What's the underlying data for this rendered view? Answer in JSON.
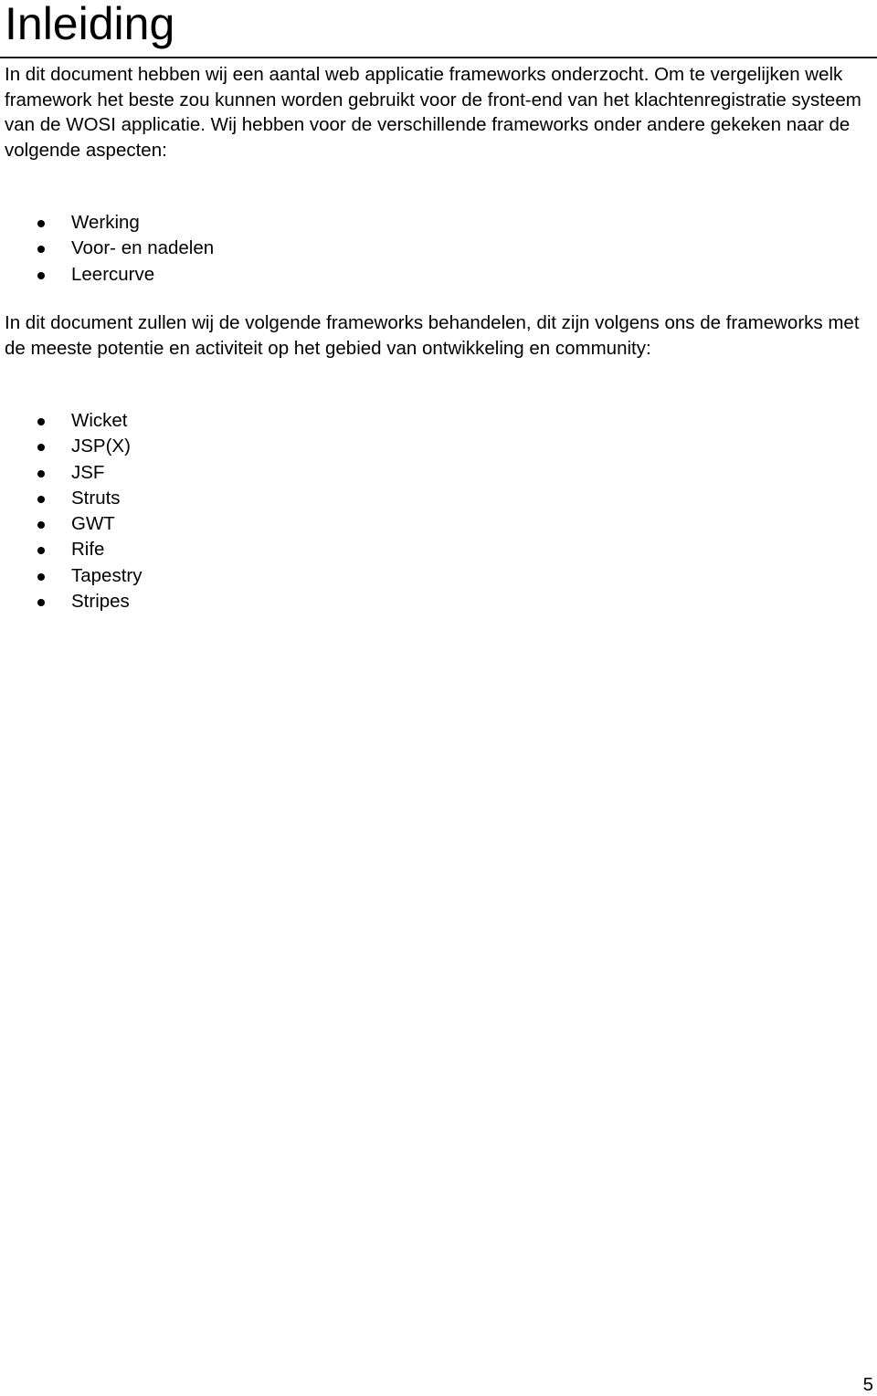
{
  "heading": "Inleiding",
  "paragraphs": [
    "In dit document hebben wij een aantal web applicatie frameworks onderzocht. Om te vergelijken welk framework het beste zou kunnen worden gebruikt voor de front-end van het klachtenregistratie systeem van de WOSI applicatie. Wij hebben voor de verschillende frameworks onder andere gekeken naar de volgende aspecten:",
    "In dit document zullen wij de volgende frameworks behandelen, dit zijn volgens ons de frameworks met de meeste potentie en activiteit op het gebied van ontwikkeling en community:"
  ],
  "aspects": [
    "Werking",
    "Voor- en nadelen",
    "Leercurve"
  ],
  "frameworks": [
    "Wicket",
    "JSP(X)",
    "JSF",
    "Struts",
    "GWT",
    "Rife",
    "Tapestry",
    "Stripes"
  ],
  "page_number": "5"
}
